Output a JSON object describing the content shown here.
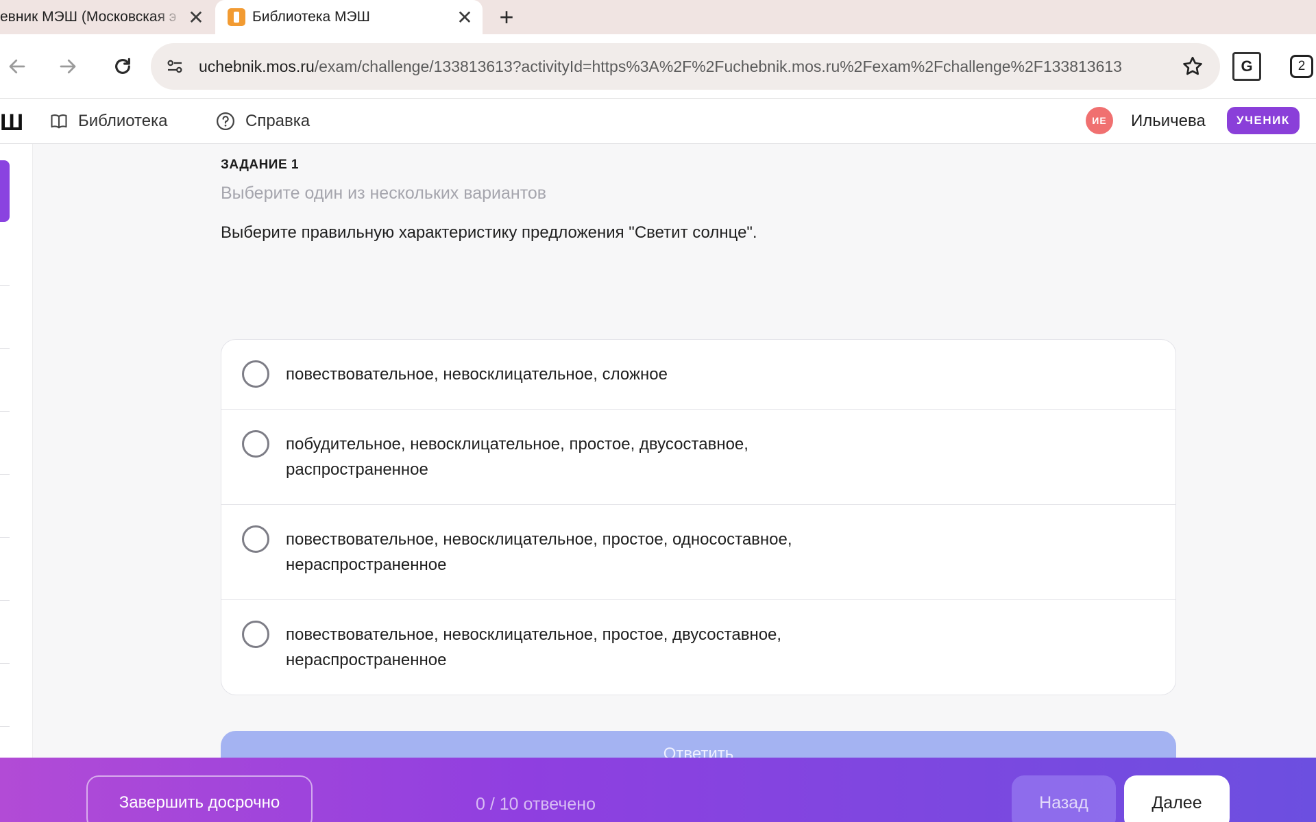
{
  "browser": {
    "tabs": [
      {
        "title": "евник МЭШ (Московская э",
        "active": false
      },
      {
        "title": "Библиотека МЭШ",
        "active": true
      }
    ],
    "url_host": "uchebnik.mos.ru",
    "url_path": "/exam/challenge/133813613?activityId=https%3A%2F%2Fuchebnik.mos.ru%2Fexam%2Fchallenge%2F133813613",
    "profile_count": "2"
  },
  "header": {
    "logo_fragment": "Ш",
    "nav": [
      {
        "label": "Библиотека",
        "icon": "book-icon"
      },
      {
        "label": "Справка",
        "icon": "help-circle-icon"
      }
    ],
    "avatar_initials": "ИЕ",
    "username": "Ильичева",
    "role": "УЧЕНИК"
  },
  "task": {
    "label": "ЗАДАНИЕ 1",
    "hint": "Выберите один из нескольких вариантов",
    "question": "Выберите правильную характеристику предложения \"Светит солнце\".",
    "options": [
      "повествовательное, невосклицательное, сложное",
      "побудительное, невосклицательное, простое, двусоставное, распространенное",
      "повествовательное, невосклицательное, простое, односоставное, нераспространенное",
      "повествовательное, невосклицательное, простое, двусоставное, нераспространенное"
    ],
    "submit_label": "Ответить"
  },
  "footer": {
    "finish_label": "Завершить досрочно",
    "progress": "0 / 10 отвечено",
    "back_label": "Назад",
    "next_label": "Далее"
  },
  "colors": {
    "accent": "#8a3fd9",
    "avatar": "#f07070",
    "submit_disabled": "#a4b3f2"
  }
}
